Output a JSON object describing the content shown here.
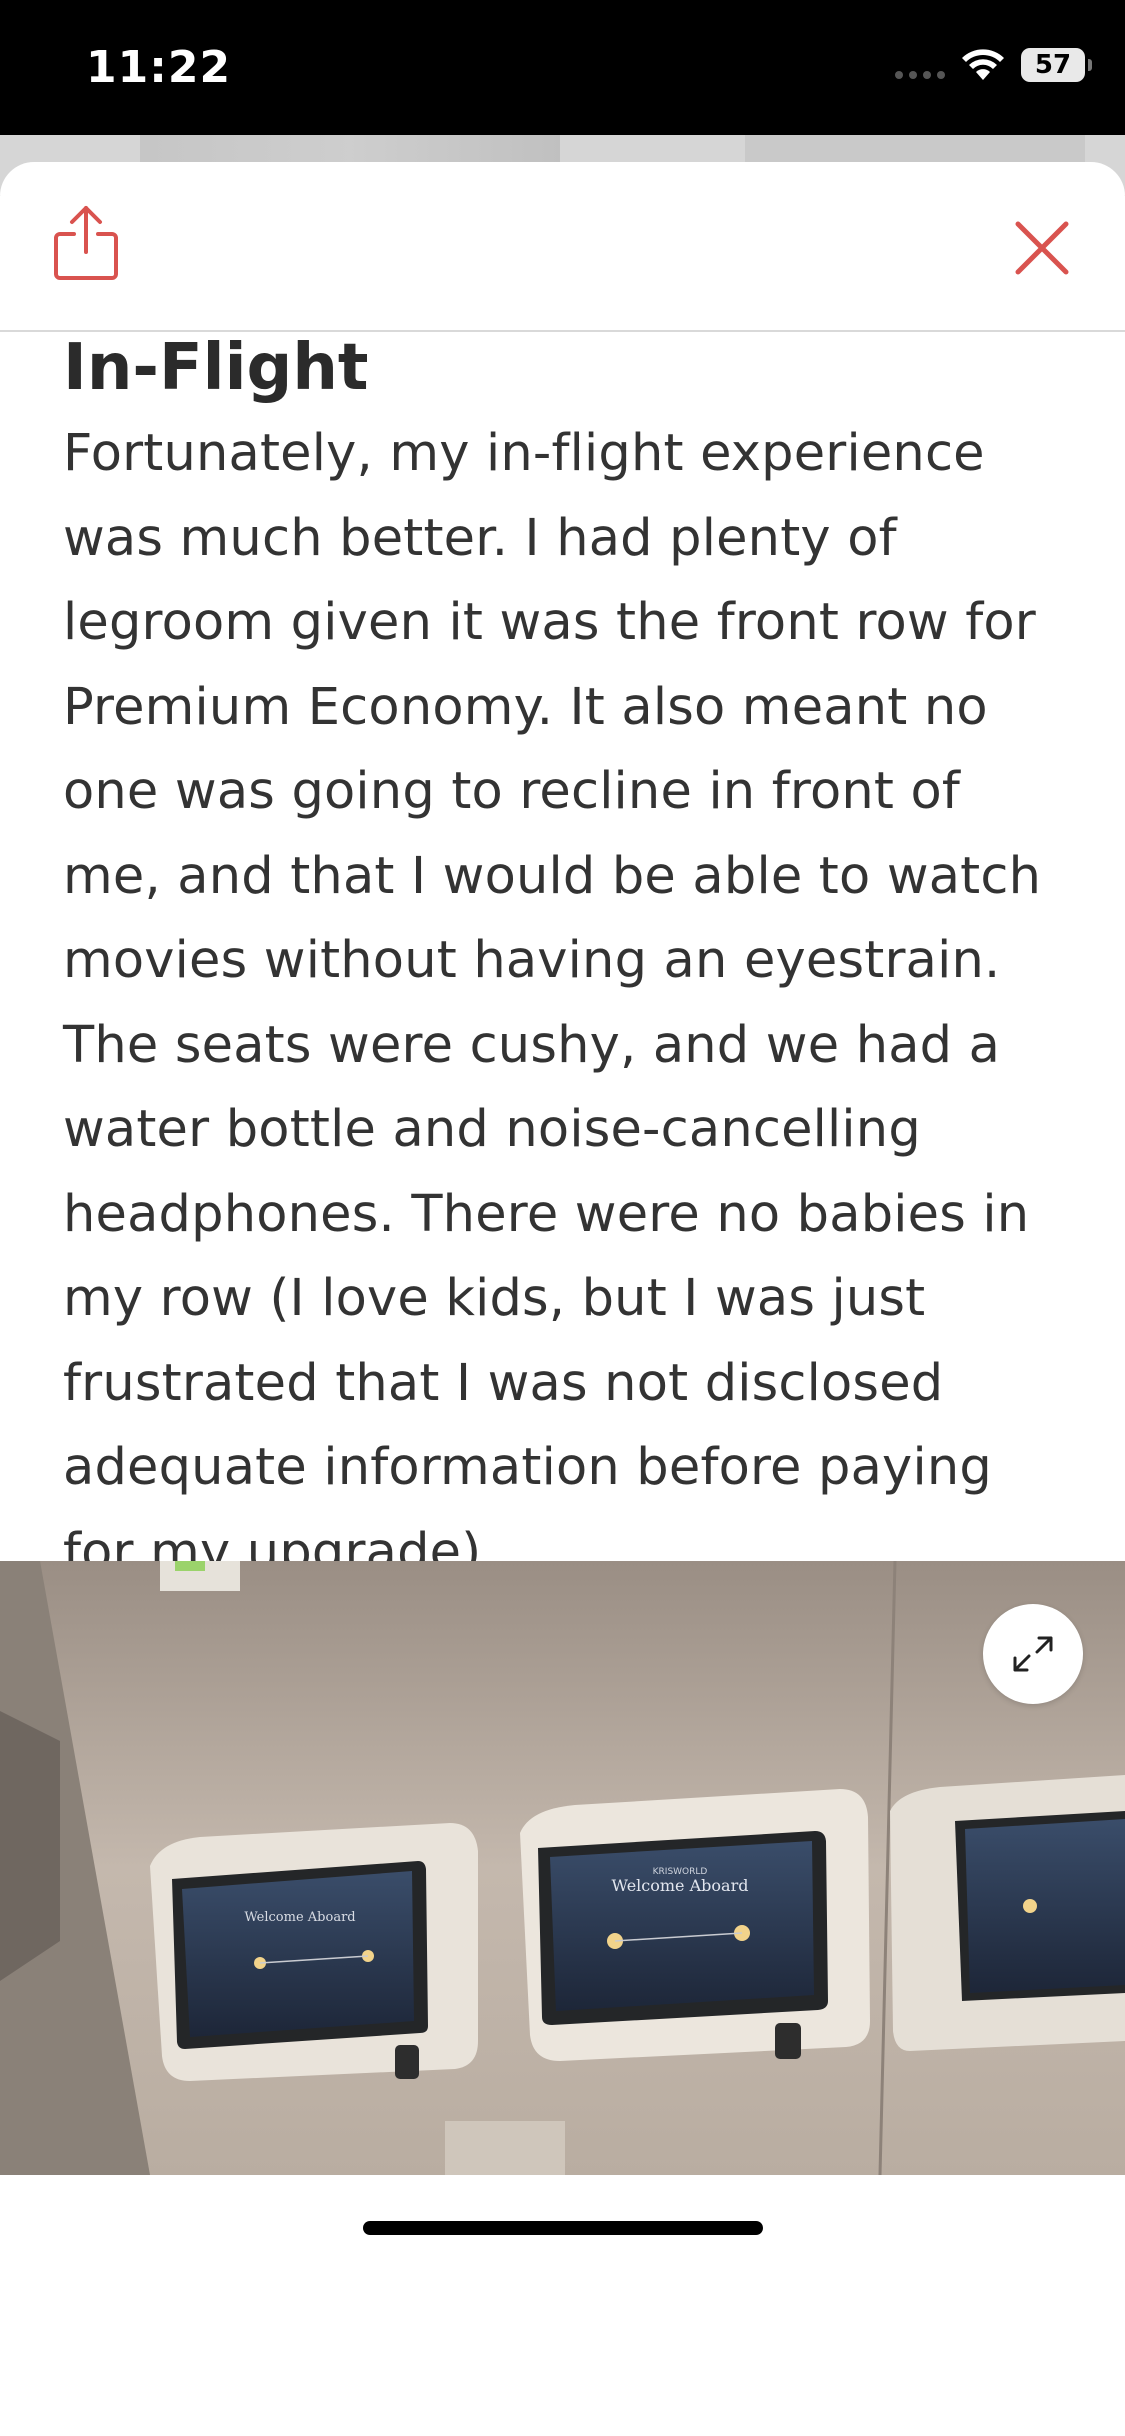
{
  "status_bar": {
    "time": "11:22",
    "battery_level": "57",
    "icons": [
      "signal-icon",
      "wifi-icon",
      "battery-icon"
    ]
  },
  "toolbar": {
    "share_icon": "share-icon",
    "close_icon": "close-icon",
    "accent_color": "#d9534f"
  },
  "article": {
    "heading": "In-Flight",
    "paragraph": "Fortunately, my in-flight experience was much better. I had plenty of legroom given it was the front row for Premium Economy. It also meant no one was going to recline in front of me, and that I would be able to watch movies without having an eyestrain. The seats were cushy, and we had a water bottle and noise-cancelling headphones. There were no babies in my row (I love kids, but I was just frustrated that I was not disclosed adequate information before paying for my upgrade)."
  },
  "photo": {
    "expand_icon": "expand-icon",
    "screen_texts": {
      "welcome": "Welcome Aboard",
      "brand": "KRISWORLD"
    }
  }
}
